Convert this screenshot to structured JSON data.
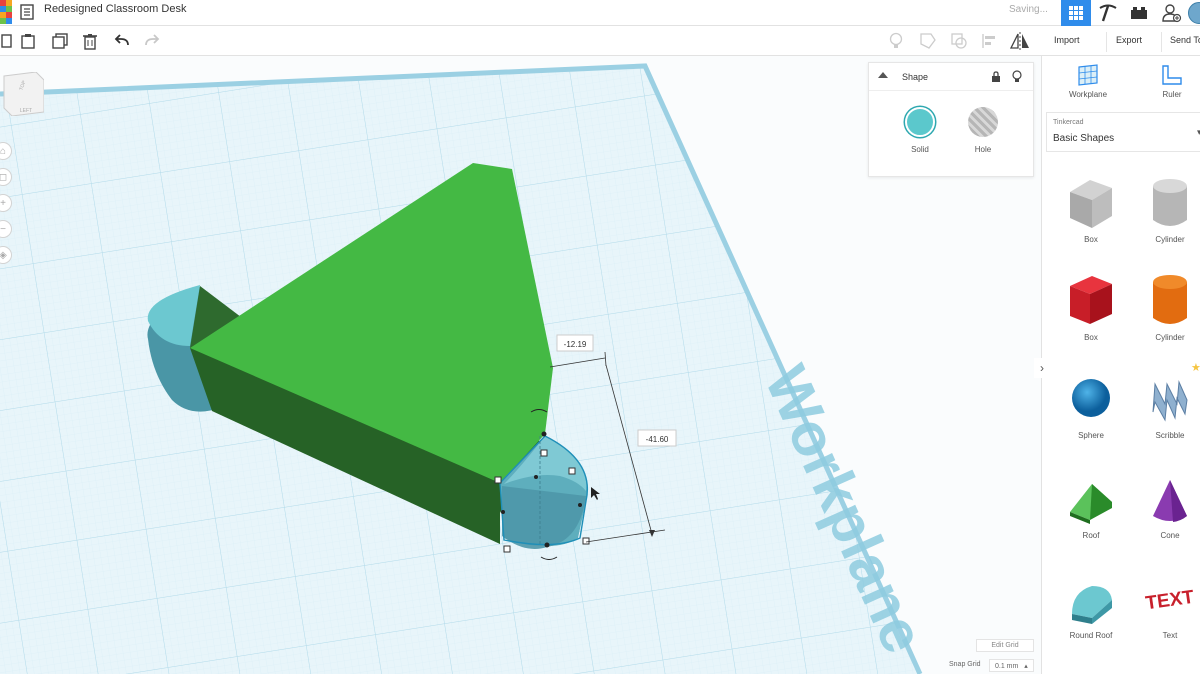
{
  "app": {
    "title": "Redesigned Classroom Desk",
    "status": "Saving..."
  },
  "toolbar": {
    "import": "Import",
    "export": "Export",
    "send": "Send To"
  },
  "viewcube": {
    "face_top": "TOP",
    "face_left": "LEFT"
  },
  "shape_panel": {
    "title": "Shape",
    "solid": "Solid",
    "hole": "Hole",
    "solid_color": "#5bc8cc"
  },
  "workplane": {
    "label": "Workplane",
    "dim_x": "-12.19",
    "dim_y": "-41.60"
  },
  "grid": {
    "edit": "Edit Grid",
    "snap_label": "Snap Grid",
    "snap_value": "0.1 mm"
  },
  "right_panel": {
    "workplane": "Workplane",
    "ruler": "Ruler",
    "library_source": "Tinkercad",
    "library_name": "Basic Shapes",
    "shapes": [
      {
        "label": "Box"
      },
      {
        "label": "Cylinder"
      },
      {
        "label": "Box"
      },
      {
        "label": "Cylinder"
      },
      {
        "label": "Sphere"
      },
      {
        "label": "Scribble"
      },
      {
        "label": "Roof"
      },
      {
        "label": "Cone"
      },
      {
        "label": "Round Roof"
      },
      {
        "label": "Text",
        "glyph": "TEXT"
      }
    ]
  },
  "colors": {
    "accent": "#2f8ceb",
    "shape_green": "#44b944",
    "shape_cyan": "#5bc8cc",
    "grid": "#cfe8f2"
  }
}
